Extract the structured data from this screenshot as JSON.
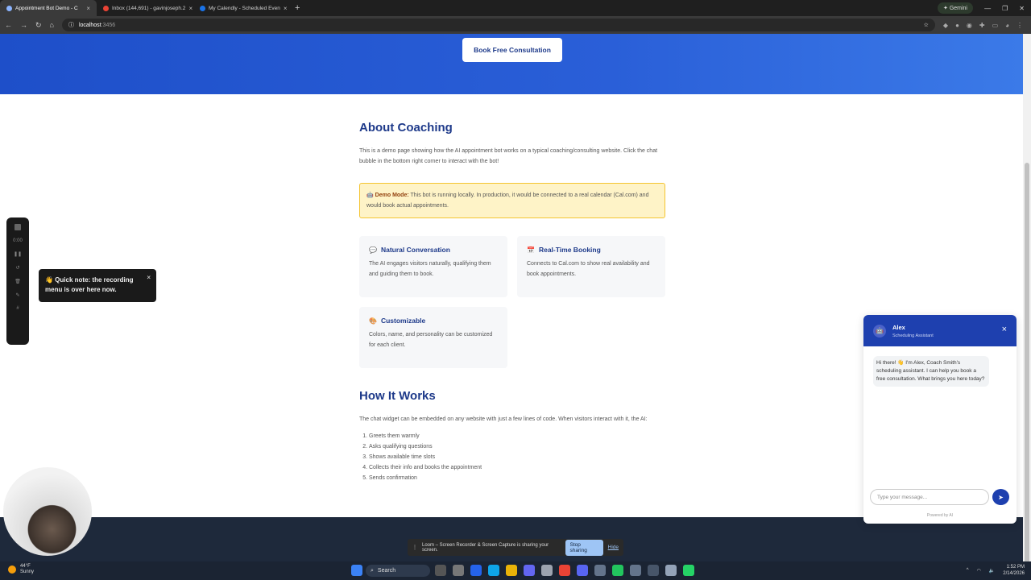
{
  "browser": {
    "tabs": [
      {
        "title": "Appointment Bot Demo - C",
        "active": true
      },
      {
        "title": "Inbox (144,691) - gavinjoseph.2",
        "active": false
      },
      {
        "title": "My Calendly - Scheduled Even",
        "active": false
      }
    ],
    "new_tab": "+",
    "gemini_label": "Gemini",
    "url_host": "localhost",
    "url_port": ":3456"
  },
  "hero": {
    "book_label": "Book Free Consultation"
  },
  "about": {
    "title": "About Coaching",
    "paragraph": "This is a demo page showing how the AI appointment bot works on a typical coaching/consulting website. Click the chat bubble in the bottom right corner to interact with the bot!",
    "demo_label": "Demo Mode:",
    "demo_text": " This bot is running locally. In production, it would be connected to a real calendar (Cal.com) and would book actual appointments."
  },
  "features": [
    {
      "icon": "💬",
      "title": "Natural Conversation",
      "text": "The AI engages visitors naturally, qualifying them and guiding them to book."
    },
    {
      "icon": "📅",
      "title": "Real-Time Booking",
      "text": "Connects to Cal.com to show real availability and book appointments."
    },
    {
      "icon": "🎨",
      "title": "Customizable",
      "text": "Colors, name, and personality can be customized for each client."
    }
  ],
  "how": {
    "title": "How It Works",
    "paragraph": "The chat widget can be embedded on any website with just a few lines of code. When visitors interact with it, the AI:",
    "steps": [
      "Greets them warmly",
      "Asks qualifying questions",
      "Shows available time slots",
      "Collects their info and books the appointment",
      "Sends confirmation"
    ]
  },
  "recording": {
    "time": "0:00",
    "tooltip": "👋 Quick note: the recording menu is over here now.",
    "tooltip_close": "×"
  },
  "chat": {
    "name": "Alex",
    "role": "Scheduling Assistant",
    "close": "×",
    "message": "Hi there! 👋 I'm Alex, Coach Smith's scheduling assistant. I can help you book a free consultation. What brings you here today?",
    "input_placeholder": "Type your message...",
    "powered": "Powered by AI"
  },
  "loom": {
    "text": "Loom – Screen Recorder & Screen Capture is sharing your screen.",
    "stop_label": "Stop sharing",
    "hide_label": "Hide"
  },
  "taskbar": {
    "temp": "44°F",
    "condition": "Sunny",
    "search_label": "Search",
    "time": "1:52 PM",
    "date": "2/14/2026"
  },
  "colors": {
    "accent": "#1e40af",
    "hero": "#2a5fd8",
    "heading": "#1e3a8a",
    "warning_bg": "#fef3c7"
  }
}
